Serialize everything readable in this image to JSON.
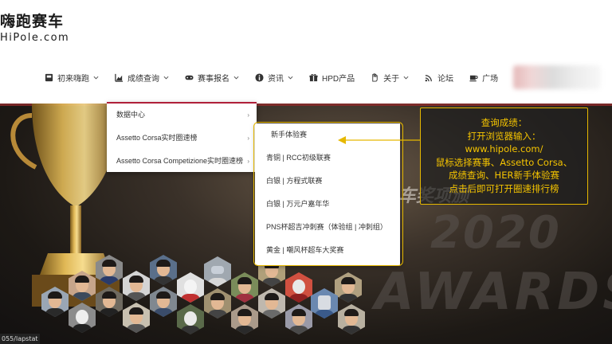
{
  "logo": {
    "cn": "嗨跑赛车",
    "en": "HiPole.com"
  },
  "nav": [
    {
      "label": "初来嗨跑",
      "icon": "box-icon",
      "has_dropdown": true
    },
    {
      "label": "成绩查询",
      "icon": "chart-icon",
      "has_dropdown": true
    },
    {
      "label": "赛事报名",
      "icon": "gamepad-icon",
      "has_dropdown": true
    },
    {
      "label": "资讯",
      "icon": "info-icon",
      "has_dropdown": true
    },
    {
      "label": "HPD产品",
      "icon": "gift-icon",
      "has_dropdown": false
    },
    {
      "label": "关于",
      "icon": "hand-icon",
      "has_dropdown": true
    },
    {
      "label": "论坛",
      "icon": "wifi-icon",
      "has_dropdown": false
    },
    {
      "label": "广场",
      "icon": "coffee-icon",
      "has_dropdown": false
    }
  ],
  "dropdown": {
    "items": [
      {
        "label": "数据中心",
        "has_submenu": true
      },
      {
        "label": "Assetto Corsa实时圈速榜",
        "has_submenu": true
      },
      {
        "label": "Assetto Corsa Competizione实时圈速榜",
        "has_submenu": true
      }
    ]
  },
  "submenu": {
    "items": [
      {
        "label": "新手体验赛"
      },
      {
        "label": "青铜 | RCC初级联赛"
      },
      {
        "label": "白银 | 方程式联赛"
      },
      {
        "label": "白银 | 万元户嘉年华"
      },
      {
        "label": "PNS杯超吉冲刺赛（体验组 | 冲刺组）"
      },
      {
        "label": "黄金 | 嘲风杯超车大奖赛"
      }
    ]
  },
  "callout": {
    "lines": [
      "查询成绩：",
      "打开浏览器输入：",
      "www.hipole.com/",
      "鼠标选择赛事、Assetto Corsa、",
      "成绩查询、HER新手体验赛",
      "点击后即可打开圈速排行榜"
    ]
  },
  "banner": {
    "bg_cn": "车奖项颁",
    "bg_year": "2020",
    "bg_awards": "AWARDS"
  },
  "url_hint": "055/lapstat",
  "colors": {
    "accent": "#b0203a",
    "callout_border": "#e6b800",
    "callout_text": "#f5c400"
  }
}
